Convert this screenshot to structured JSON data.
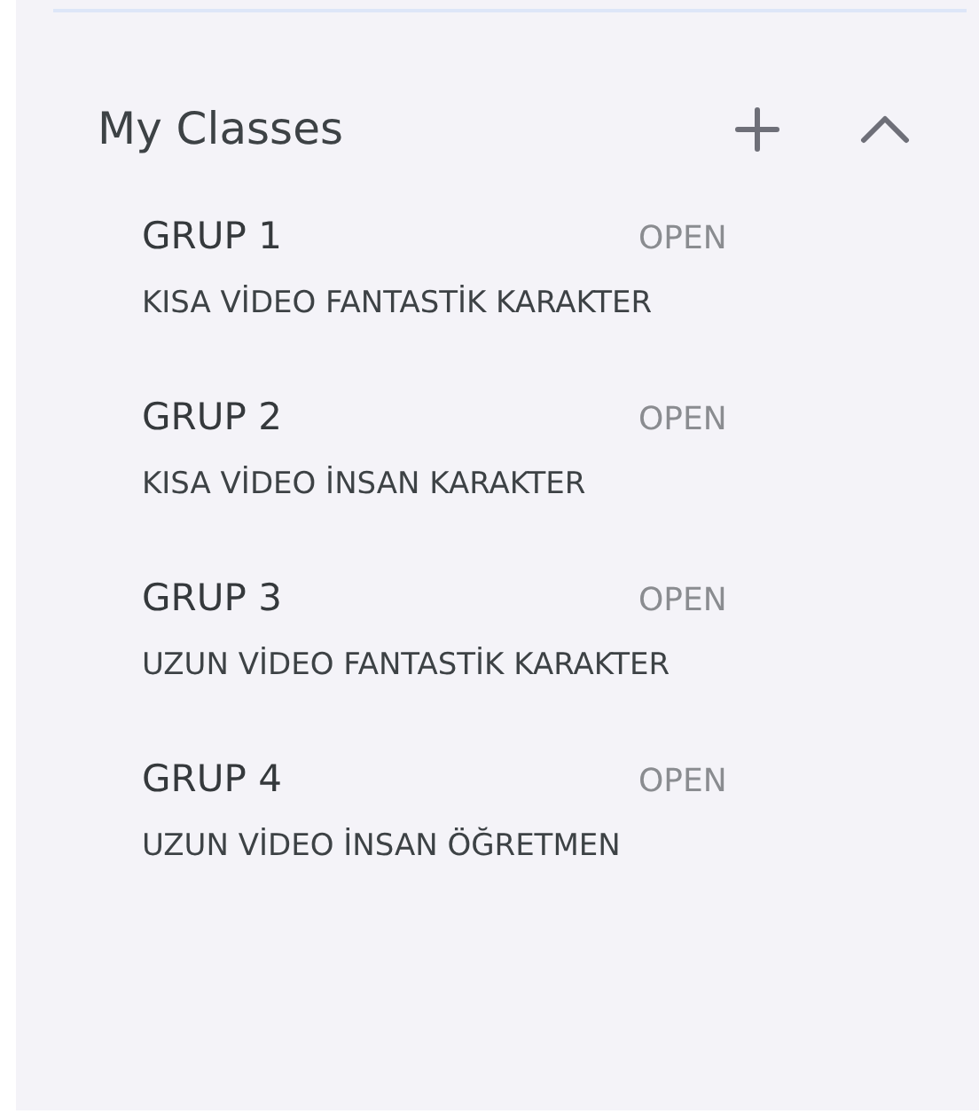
{
  "section": {
    "title": "My Classes",
    "expanded": true
  },
  "classes": [
    {
      "name": "GRUP 1",
      "status": "OPEN",
      "description": "KISA VİDEO FANTASTİK KARAKTER"
    },
    {
      "name": "GRUP 2",
      "status": "OPEN",
      "description": "KISA VİDEO İNSAN KARAKTER"
    },
    {
      "name": "GRUP 3",
      "status": "OPEN",
      "description": "UZUN VİDEO FANTASTİK KARAKTER"
    },
    {
      "name": "GRUP 4",
      "status": "OPEN",
      "description": "UZUN VİDEO İNSAN ÖĞRETMEN"
    }
  ]
}
